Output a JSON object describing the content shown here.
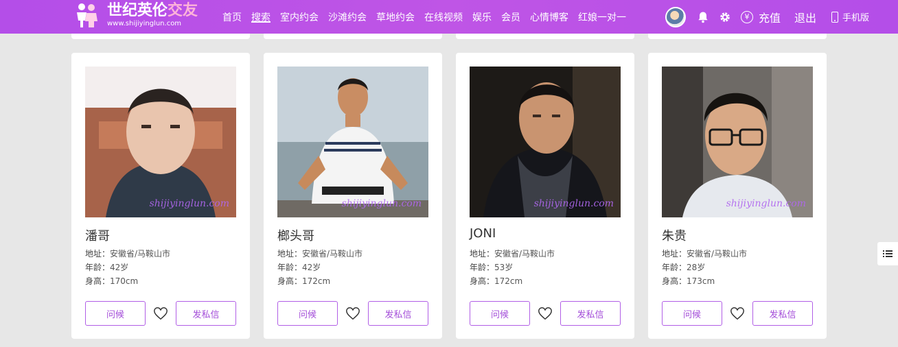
{
  "header": {
    "logo_title_main": "世纪英伦",
    "logo_title_accent": "交友",
    "logo_url": "www.shijiyinglun.com",
    "nav": [
      {
        "label": "首页",
        "active": false
      },
      {
        "label": "搜索",
        "active": true
      },
      {
        "label": "室内约会",
        "active": false
      },
      {
        "label": "沙滩约会",
        "active": false
      },
      {
        "label": "草地约会",
        "active": false
      },
      {
        "label": "在线视频",
        "active": false
      },
      {
        "label": "娱乐",
        "active": false
      },
      {
        "label": "会员",
        "active": false
      },
      {
        "label": "心情博客",
        "active": false
      },
      {
        "label": "红娘一对一",
        "active": false
      }
    ],
    "recharge_label": "充值",
    "recharge_icon": "¥",
    "logout_label": "退出",
    "mobile_label": "手机版"
  },
  "labels": {
    "address": "地址：",
    "age": "年龄：",
    "height": "身高：",
    "greet_button": "问候",
    "message_button": "发私信",
    "watermark": "shijiyinglun.com"
  },
  "profiles": [
    {
      "name": "潘哥",
      "address": "安徽省/马鞍山市",
      "age": "42岁",
      "height": "170cm"
    },
    {
      "name": "榔头哥",
      "address": "安徽省/马鞍山市",
      "age": "42岁",
      "height": "172cm"
    },
    {
      "name": "JONI",
      "address": "安徽省/马鞍山市",
      "age": "53岁",
      "height": "172cm"
    },
    {
      "name": "朱贵",
      "address": "安徽省/马鞍山市",
      "age": "28岁",
      "height": "173cm"
    }
  ],
  "colors": {
    "header_purple": "#bb52e7",
    "button_purple": "#a44ed9",
    "page_bg": "#e7e7e7"
  }
}
